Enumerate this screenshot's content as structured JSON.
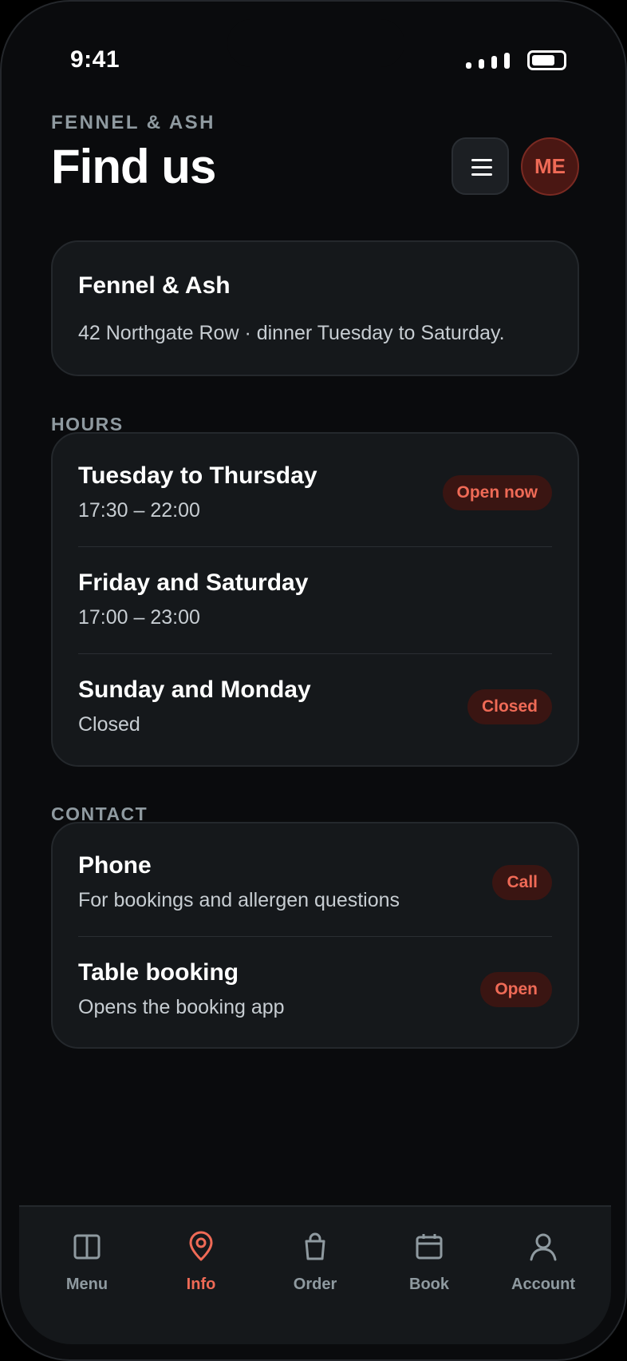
{
  "status": {
    "time": "9:41"
  },
  "header": {
    "brand": "FENNEL & ASH",
    "title": "Find us",
    "avatar_initials": "ME"
  },
  "intro": {
    "name": "Fennel & Ash",
    "description": "42 Northgate Row · dinner Tuesday to Saturday."
  },
  "hours": {
    "label": "HOURS",
    "rows": [
      {
        "title": "Tuesday to Thursday",
        "subtitle": "17:30 – 22:00",
        "badge": "Open now"
      },
      {
        "title": "Friday and Saturday",
        "subtitle": "17:00 – 23:00",
        "badge": ""
      },
      {
        "title": "Sunday and Monday",
        "subtitle": "Closed",
        "badge": "Closed"
      }
    ]
  },
  "contact": {
    "label": "CONTACT",
    "rows": [
      {
        "title": "Phone",
        "subtitle": "For bookings and allergen questions",
        "action": "Call"
      },
      {
        "title": "Table booking",
        "subtitle": "Opens the booking app",
        "action": "Open"
      }
    ]
  },
  "tabs": [
    {
      "label": "Menu",
      "icon": "book-icon",
      "active": false
    },
    {
      "label": "Info",
      "icon": "location-pin-icon",
      "active": true
    },
    {
      "label": "Order",
      "icon": "bag-icon",
      "active": false
    },
    {
      "label": "Book",
      "icon": "calendar-icon",
      "active": false
    },
    {
      "label": "Account",
      "icon": "person-icon",
      "active": false
    }
  ],
  "colors": {
    "background": "#0a0b0d",
    "card": "#15181b",
    "accent": "#ef6a56",
    "muted": "#8f9aa0"
  }
}
